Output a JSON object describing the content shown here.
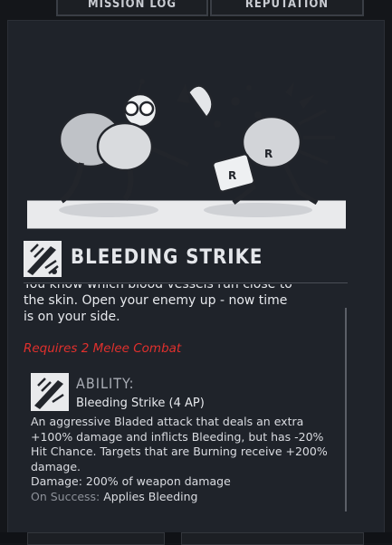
{
  "tabs": [
    {
      "label": "MISSION LOG"
    },
    {
      "label": "REPUTATION"
    }
  ],
  "skill": {
    "title": "BLEEDING STRIKE",
    "description_partial": "You know which blood vessels run close to",
    "description": "the skin. Open your enemy up - now time is on your side.",
    "requirement": "Requires 2 Melee Combat"
  },
  "ability": {
    "label": "ABILITY:",
    "name": "Bleeding Strike (4 AP)",
    "description": "An aggressive Bladed attack that deals an extra +100% damage and inflicts Bleeding, but has -20% Hit Chance. Targets that are Burning receive +200% damage.",
    "damage": "Damage: 200% of weapon damage",
    "on_success_label": "On Success:",
    "on_success_value": "Applies Bleeding"
  },
  "colors": {
    "requirement": "#e0302d",
    "background": "#1f232a"
  },
  "icons": [
    "blade-strike-icon",
    "ability-blade-icon",
    "skill-illustration"
  ]
}
